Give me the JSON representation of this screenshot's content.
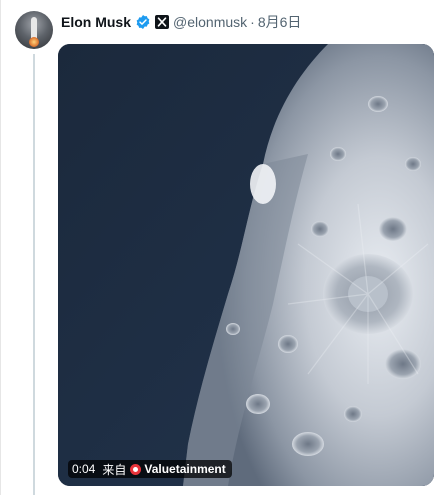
{
  "author": {
    "name": "Elon Musk",
    "handle": "@elonmusk",
    "separator": "·",
    "date": "8月6日"
  },
  "icons": {
    "verified": "verified-badge-icon",
    "affiliate": "x-logo-icon",
    "source": "source-record-icon"
  },
  "media": {
    "type": "video",
    "elapsed": "0:04",
    "from_label": "来自",
    "source": "Valuetainment"
  },
  "colors": {
    "verified_blue": "#1d9bf0",
    "thread_line": "#cfd9de",
    "space": "#1c2a3e",
    "source_red": "#e8333a"
  }
}
